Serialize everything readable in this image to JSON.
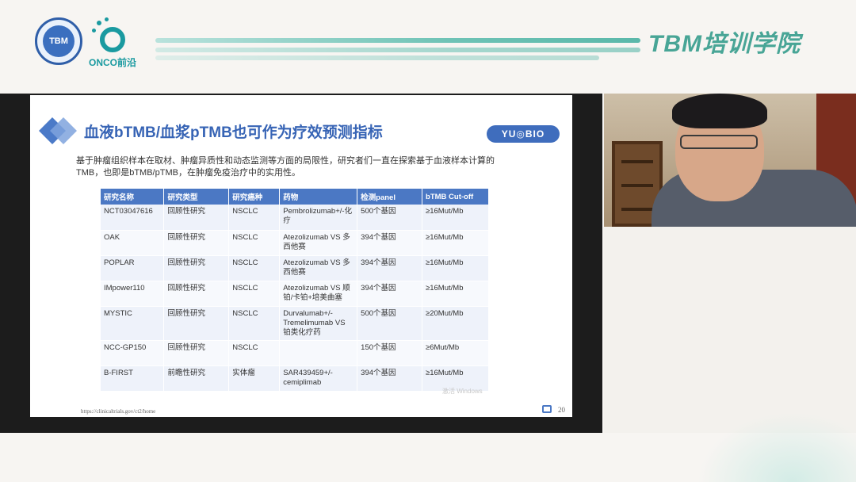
{
  "header": {
    "seal_logo_text": "TBM",
    "onco_logo_text": "ONCO前沿",
    "banner_title": "TBM培训学院"
  },
  "slide": {
    "title": "血液bTMB/血浆pTMB也可作为疗效预测指标",
    "brand_badge": "YU◎BIO",
    "intro": "基于肿瘤组织样本在取材、肿瘤异质性和动态监测等方面的局限性，研究者们一直在探索基于血液样本计算的TMB，也即是bTMB/pTMB，在肿瘤免疫治疗中的实用性。",
    "table": {
      "headers": [
        "研究名称",
        "研究类型",
        "研究癌种",
        "药物",
        "检测panel",
        "bTMB Cut-off"
      ],
      "rows": [
        [
          "NCT03047616",
          "回顾性研究",
          "NSCLC",
          "Pembrolizumab+/-化疗",
          "500个基因",
          "≥16Mut/Mb"
        ],
        [
          "OAK",
          "回顾性研究",
          "NSCLC",
          "Atezolizumab VS 多西他赛",
          "394个基因",
          "≥16Mut/Mb"
        ],
        [
          "POPLAR",
          "回顾性研究",
          "NSCLC",
          "Atezolizumab VS 多西他赛",
          "394个基因",
          "≥16Mut/Mb"
        ],
        [
          "IMpower110",
          "回顾性研究",
          "NSCLC",
          "Atezolizumab VS 顺铂/卡铂+培美曲塞",
          "394个基因",
          "≥16Mut/Mb"
        ],
        [
          "MYSTIC",
          "回顾性研究",
          "NSCLC",
          "Durvalumab+/-Tremelimumab VS 铂类化疗药",
          "500个基因",
          "≥20Mut/Mb"
        ],
        [
          "NCC-GP150",
          "回顾性研究",
          "NSCLC",
          "",
          "150个基因",
          "≥6Mut/Mb"
        ],
        [
          "B-FIRST",
          "前瞻性研究",
          "实体瘤",
          "SAR439459+/-cemiplimab",
          "394个基因",
          "≥16Mut/Mb"
        ]
      ]
    },
    "footer_link": "https://clinicaltrials.gov/ct2/home",
    "page_number": "20",
    "watermark": "激活 Windows"
  },
  "colors": {
    "accent_teal": "#48a596",
    "slide_blue": "#3764b5",
    "table_header": "#4b78c4"
  }
}
